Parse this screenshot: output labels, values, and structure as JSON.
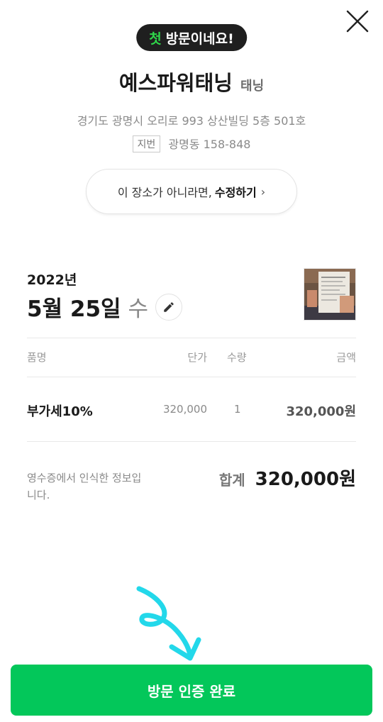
{
  "header": {
    "close_icon": "close-icon",
    "badge": {
      "accent": "첫",
      "text": "방문이네요!"
    }
  },
  "place": {
    "name": "예스파워태닝",
    "category": "태닝",
    "address": "경기도 광명시 오리로 993 상산빌딩 5층 501호",
    "jibun_tag": "지번",
    "jibun_address": "광명동 158-848",
    "edit_prompt": "이 장소가 아니라면,",
    "edit_action": "수정하기",
    "edit_chevron": "›"
  },
  "receipt": {
    "year": "2022년",
    "date": "5월 25일",
    "weekday": "수",
    "thumbnail": "receipt-photo",
    "headers": {
      "item": "품명",
      "unit_price": "단가",
      "qty": "수량",
      "amount": "금액"
    },
    "items": [
      {
        "name": "부가세10%",
        "unit_price": "320,000",
        "qty": "1",
        "amount": "320,000원"
      }
    ],
    "note": "영수증에서 인식한 정보입니다.",
    "total_label": "합계",
    "total_amount": "320,000원"
  },
  "footer": {
    "complete_label": "방문 인증 완료"
  },
  "colors": {
    "accent_green": "#03c75a",
    "badge_bg": "#1f1f1f",
    "badge_accent": "#2fd64a",
    "annotation_arrow": "#23d8ea"
  }
}
